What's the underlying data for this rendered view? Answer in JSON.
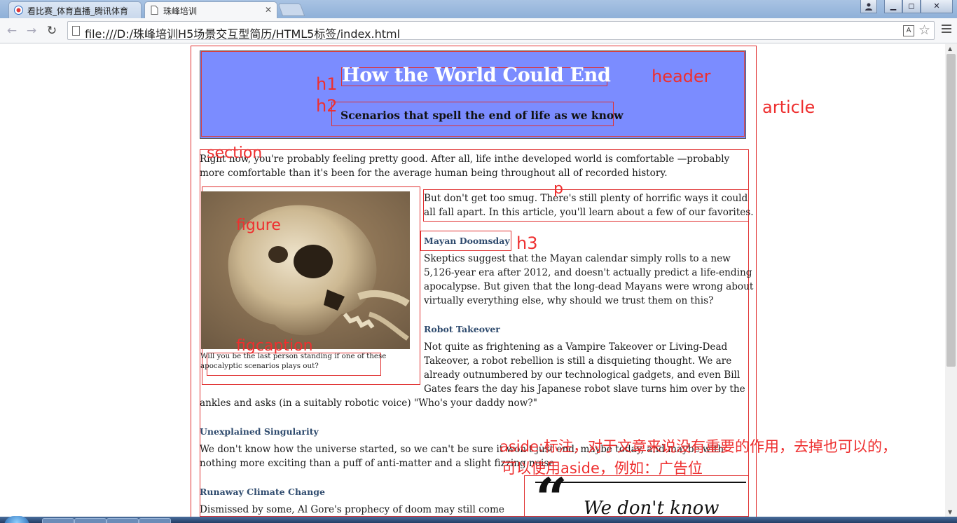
{
  "browser": {
    "tabs": [
      {
        "title": "看比赛_体育直播_腾讯体育",
        "active": false
      },
      {
        "title": "珠峰培训",
        "active": true
      }
    ],
    "url": "file:///D:/珠峰培训H5场景交互型简历/HTML5标签/index.html",
    "colors": {
      "titlebar": "#9fbadf",
      "toolbar": "#f6f7f9"
    }
  },
  "page": {
    "header": {
      "h1": "How the World Could End",
      "h2": "Scenarios that spell the end of life as we know",
      "background": "#7b8cff"
    },
    "section": {
      "intro": [
        "Right now, you're probably feeling pretty good. After all, life inthe developed world is comfortable —probably",
        "more comfortable than it's been for the average human being throughout all of recorded history."
      ],
      "p": [
        "But don't get too smug. There's still plenty of horrific ways it could",
        "all fall apart. In this article, you'll learn about a few of our favorites."
      ],
      "figcaption": [
        "Will you be the last person standing if one of these",
        "apocalyptic scenarios plays out?"
      ],
      "items": [
        {
          "h3": "Mayan Doomsday",
          "lines": [
            "Skeptics suggest that the Mayan calendar simply rolls to a new",
            "5,126-year era after 2012, and doesn't actually predict a life-ending",
            "apocalypse. But given that the long-dead Mayans were wrong about",
            "virtually everything else, why should we trust them on this?"
          ]
        },
        {
          "h3": "Robot Takeover",
          "lines": [
            "Not quite as frightening as a Vampire Takeover or Living-Dead",
            "Takeover, a robot rebellion is still a disquieting thought. We are",
            "already outnumbered by our technological gadgets, and even Bill",
            "Gates fears the day his Japanese robot slave turns him over by the",
            "ankles and asks (in a suitably robotic voice) \"Who's your daddy now?\""
          ]
        },
        {
          "h3": "Unexplained Singularity",
          "lines": [
            "We don't know how the universe started, so we can't be sure it won't just end, maybe today, and maybe with",
            "nothing more exciting than a puff of anti-matter and a slight fizzing noise."
          ]
        },
        {
          "h3": "Runaway Climate Change",
          "lines": [
            "Dismissed by some, Al Gore's prophecy of doom may still come"
          ]
        }
      ]
    },
    "aside": {
      "quote_mark": "“",
      "quote": "We don't know"
    },
    "annotations": {
      "header": "header",
      "article": "article",
      "h1": "h1",
      "h2": "h2",
      "section": "section",
      "p": "p",
      "figure": "figure",
      "h3": "h3",
      "figcaption": "figcaption",
      "aside_line1": "aside:标注，对于文章来说没有重要的作用，去掉也可以的，",
      "aside_line2": "可以使用aside，例如：广告位",
      "color": "#ee2f2f"
    }
  }
}
